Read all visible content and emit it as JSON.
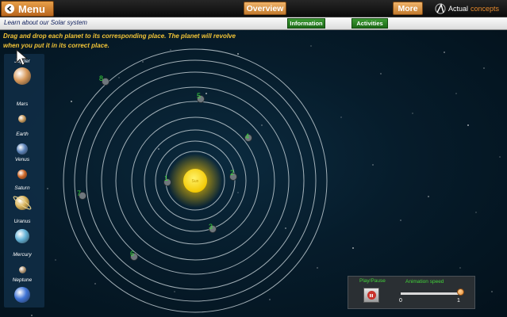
{
  "topbar": {
    "menu_label": "Menu",
    "overview_label": "Overview",
    "more_label": "More",
    "brand_part1": "Actual",
    "brand_part2": "concepts"
  },
  "subbar": {
    "subtitle": "Learn about our Solar system",
    "information_label": "Information",
    "activities_label": "Activities"
  },
  "instructions": "Drag and drop each planet to its corresponding place. The planet will revolve when you put it in its correct place.",
  "planets": [
    {
      "name": "Jupiter",
      "color": "#d89a5c"
    },
    {
      "name": "Mars",
      "color": "#c79a5e"
    },
    {
      "name": "Earth",
      "color": "#5b82b8"
    },
    {
      "name": "Venus",
      "color": "#d06a2a"
    },
    {
      "name": "Saturn",
      "color": "#d9b35a"
    },
    {
      "name": "Uranus",
      "color": "#64b3d8"
    },
    {
      "name": "Mercury",
      "color": "#b59a78"
    },
    {
      "name": "Neptune",
      "color": "#3f74d6"
    }
  ],
  "sun": {
    "label": "Sun",
    "color": "#f7d40a"
  },
  "slots": [
    "1",
    "2",
    "3",
    "4",
    "5",
    "6",
    "7",
    "8"
  ],
  "animation": {
    "playpause_label": "Play/Pause",
    "speed_label": "Animation speed",
    "min_label": "0",
    "max_label": "1",
    "speed_value": 1
  },
  "colors": {
    "accent_orange": "#e58a2e",
    "accent_green": "#2a8a22",
    "slot_number": "#39d63a",
    "instruction_text": "#f2c437"
  }
}
